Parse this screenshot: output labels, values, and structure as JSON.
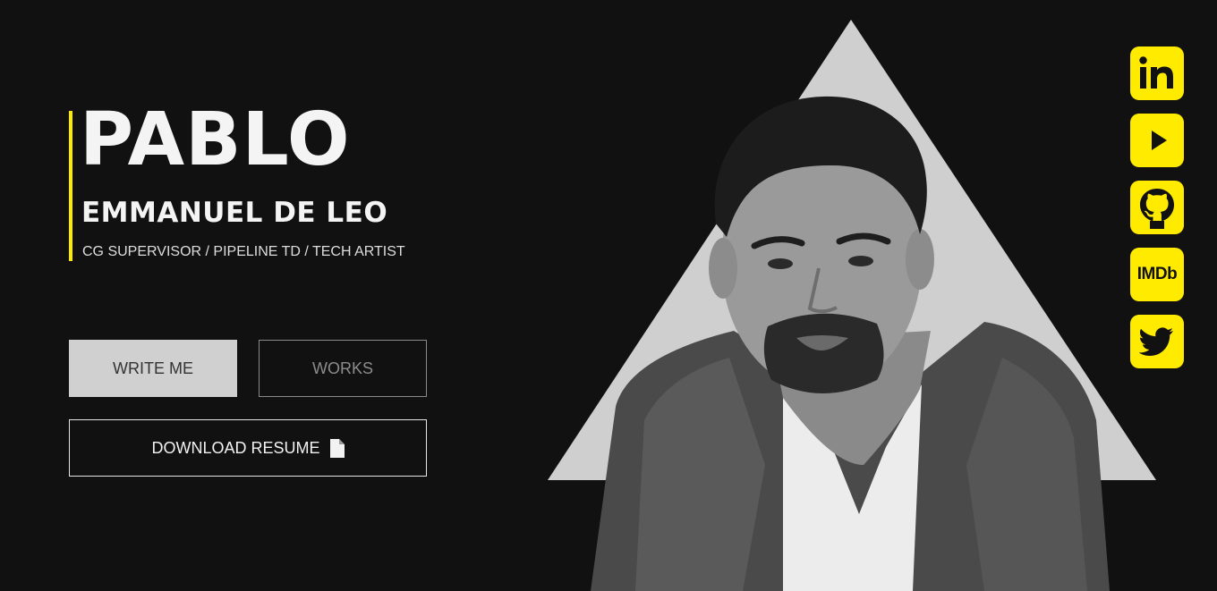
{
  "hero": {
    "first_name": "PABLO",
    "last_name": "EMMANUEL DE LEO",
    "role": "CG SUPERVISOR / PIPELINE TD / TECH ARTIST"
  },
  "buttons": {
    "write_me": "WRITE ME",
    "works": "WORKS",
    "download_resume": "DOWNLOAD RESUME"
  },
  "icons": {
    "resume": "file-icon"
  },
  "social": [
    {
      "name": "linkedin-icon",
      "label": "in"
    },
    {
      "name": "youtube-icon",
      "label": ""
    },
    {
      "name": "github-icon",
      "label": ""
    },
    {
      "name": "imdb-icon",
      "label": "IMDb"
    },
    {
      "name": "twitter-icon",
      "label": ""
    }
  ],
  "colors": {
    "background": "#111111",
    "accent": "#ffeb00",
    "triangle": "#cfcfcf",
    "text": "#f2f2f2"
  }
}
